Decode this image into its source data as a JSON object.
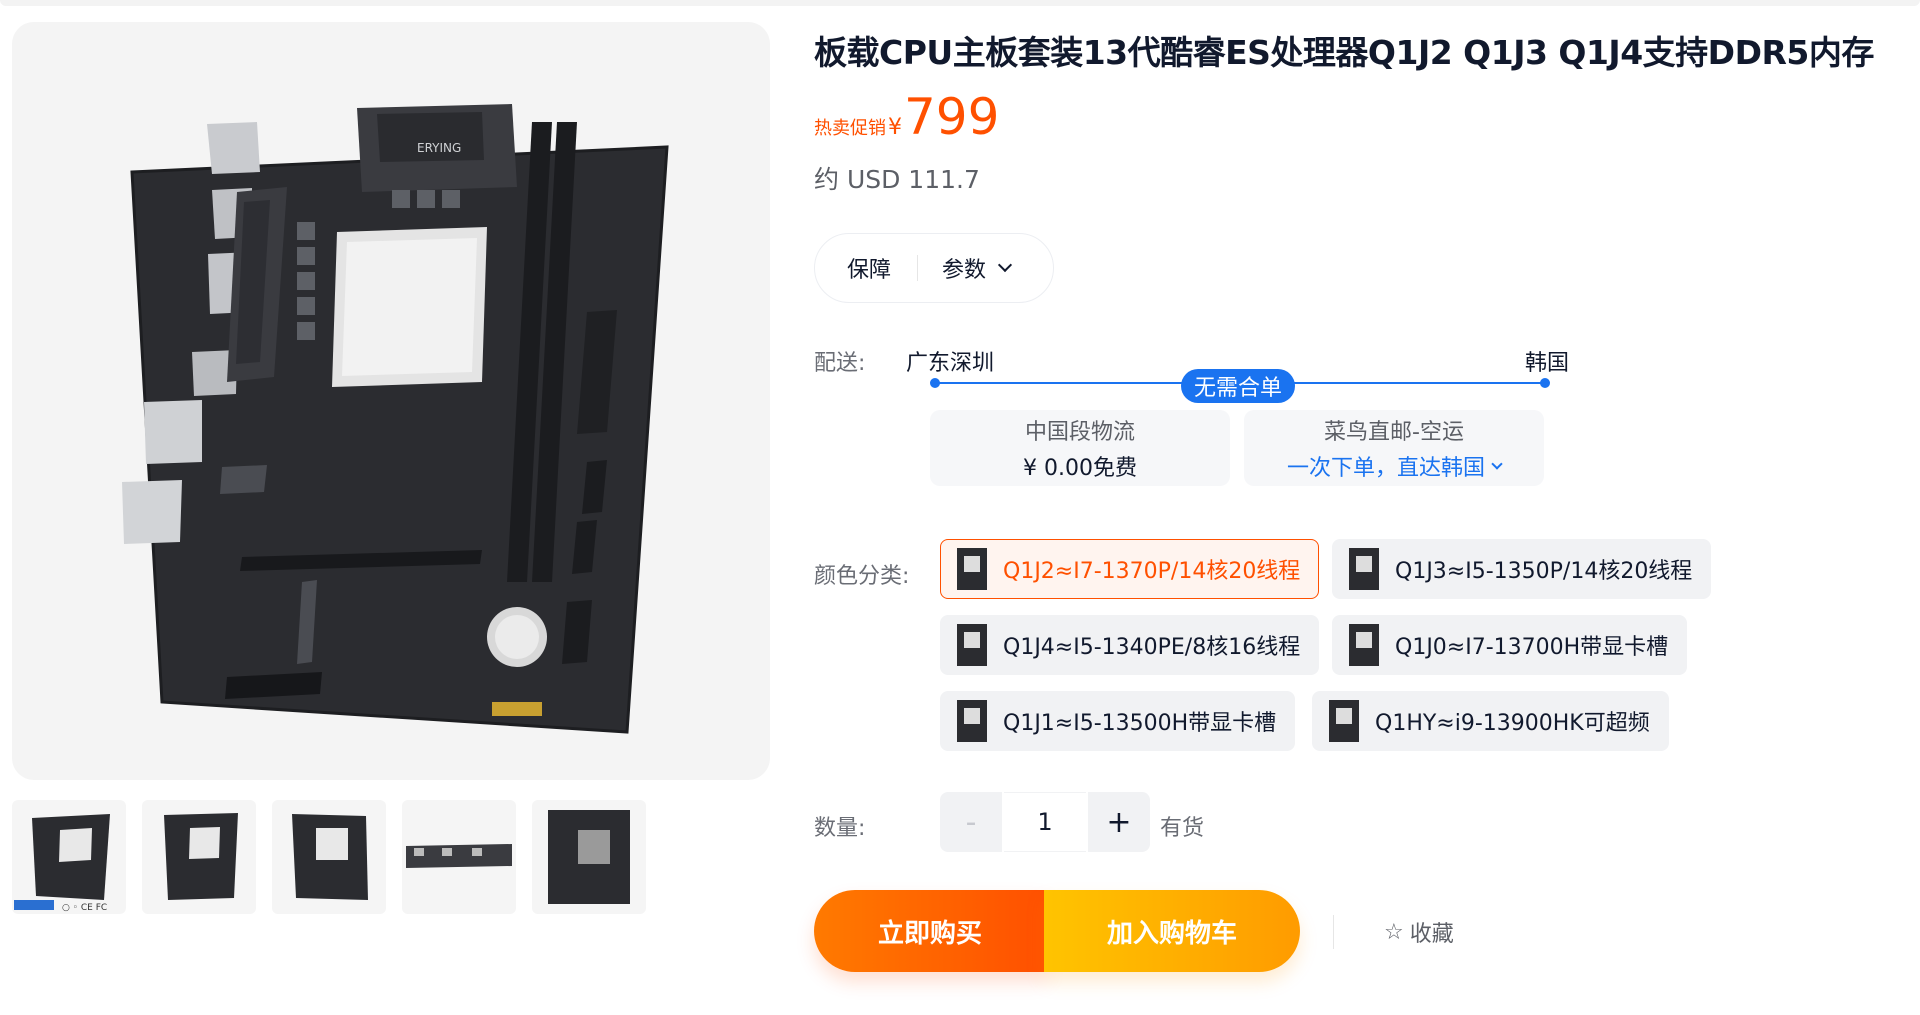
{
  "product": {
    "title": "板载CPU主板套装13代酷睿ES处理器Q1J2 Q1J3 Q1J4支持DDR5内存",
    "promo_label": "热卖促销",
    "currency_symbol": "¥",
    "price": "799",
    "usd_price": "约 USD 111.7",
    "board_brand": "ERYING"
  },
  "info_tabs": {
    "guarantee": "保障",
    "params": "参数"
  },
  "shipping": {
    "label": "配送:",
    "from": "广东深圳",
    "to": "韩国",
    "route_badge": "无需合单",
    "domestic": {
      "title": "中国段物流",
      "fee": "¥ 0.00免费"
    },
    "intl": {
      "title": "菜鸟直邮-空运",
      "desc": "一次下单，直达韩国"
    }
  },
  "variants": {
    "label": "颜色分类:",
    "options": [
      {
        "name": "Q1J2≈I7-1370P/14核20线程",
        "selected": true
      },
      {
        "name": "Q1J3≈I5-1350P/14核20线程",
        "selected": false
      },
      {
        "name": "Q1J4≈I5-1340PE/8核16线程",
        "selected": false
      },
      {
        "name": "Q1J0≈I7-13700H带显卡槽",
        "selected": false
      },
      {
        "name": "Q1J1≈I5-13500H带显卡槽",
        "selected": false
      },
      {
        "name": "Q1HY≈i9-13900HK可超频",
        "selected": false
      }
    ]
  },
  "quantity": {
    "label": "数量:",
    "minus": "-",
    "value": "1",
    "plus": "+",
    "stock": "有货"
  },
  "actions": {
    "buy_now": "立即购买",
    "add_cart": "加入购物车",
    "favorite": "收藏"
  },
  "colors": {
    "accent": "#ff5000",
    "link": "#1a73f0",
    "cart": "#ffb000"
  },
  "icons": [
    "chevron-down-icon",
    "star-outline-icon"
  ]
}
